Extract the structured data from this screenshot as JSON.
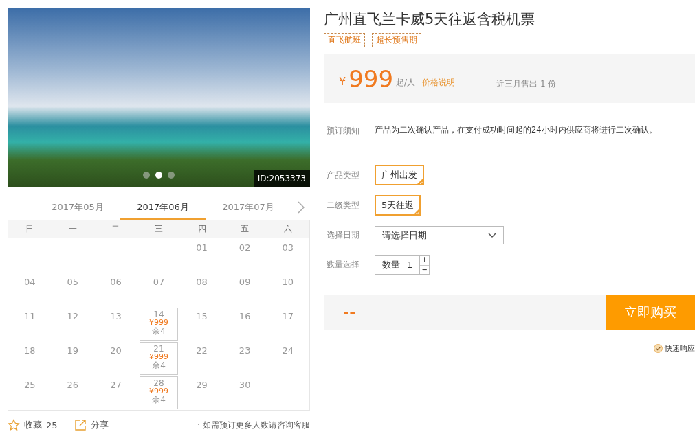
{
  "gallery": {
    "id_label": "ID:2053373",
    "dots": [
      {
        "selected": false
      },
      {
        "selected": true
      },
      {
        "selected": false
      }
    ]
  },
  "calendar": {
    "months": [
      {
        "label": "2017年05月",
        "selected": false
      },
      {
        "label": "2017年06月",
        "selected": true
      },
      {
        "label": "2017年07月",
        "selected": false
      }
    ],
    "weekdays": [
      "日",
      "一",
      "二",
      "三",
      "四",
      "五",
      "六"
    ],
    "weeks": [
      [
        {
          "kind": "blank"
        },
        {
          "kind": "blank"
        },
        {
          "kind": "blank"
        },
        {
          "kind": "blank"
        },
        {
          "kind": "date",
          "day": "01"
        },
        {
          "kind": "date",
          "day": "02"
        },
        {
          "kind": "date",
          "day": "03"
        }
      ],
      [
        {
          "kind": "date",
          "day": "04"
        },
        {
          "kind": "date",
          "day": "05"
        },
        {
          "kind": "date",
          "day": "06"
        },
        {
          "kind": "date",
          "day": "07"
        },
        {
          "kind": "date",
          "day": "08"
        },
        {
          "kind": "date",
          "day": "09"
        },
        {
          "kind": "date",
          "day": "10"
        }
      ],
      [
        {
          "kind": "date",
          "day": "11"
        },
        {
          "kind": "date",
          "day": "12"
        },
        {
          "kind": "date",
          "day": "13"
        },
        {
          "kind": "available",
          "day": "14",
          "price": "¥999",
          "remaining": "余4"
        },
        {
          "kind": "date",
          "day": "15"
        },
        {
          "kind": "date",
          "day": "16"
        },
        {
          "kind": "date",
          "day": "17"
        }
      ],
      [
        {
          "kind": "date",
          "day": "18"
        },
        {
          "kind": "date",
          "day": "19"
        },
        {
          "kind": "date",
          "day": "20"
        },
        {
          "kind": "available",
          "day": "21",
          "price": "¥999",
          "remaining": "余4"
        },
        {
          "kind": "date",
          "day": "22"
        },
        {
          "kind": "date",
          "day": "23"
        },
        {
          "kind": "date",
          "day": "24"
        }
      ],
      [
        {
          "kind": "date",
          "day": "25"
        },
        {
          "kind": "date",
          "day": "26"
        },
        {
          "kind": "date",
          "day": "27"
        },
        {
          "kind": "available",
          "day": "28",
          "price": "¥999",
          "remaining": "余4"
        },
        {
          "kind": "date",
          "day": "29"
        },
        {
          "kind": "date",
          "day": "30"
        },
        {
          "kind": "blank"
        }
      ]
    ]
  },
  "actions": {
    "favorite": "收藏",
    "favorite_count": "25",
    "share": "分享",
    "note": "· 如需预订更多人数请咨询客服"
  },
  "product": {
    "title": "广州直飞兰卡威5天往返含税机票",
    "tags": [
      "直飞航班",
      "超长预售期"
    ],
    "price": {
      "currency": "¥",
      "amount": "999",
      "unit": "起/人",
      "explain_link": "价格说明",
      "sales": "近三月售出 1 份"
    },
    "notice": {
      "label": "预订须知",
      "text": "产品为二次确认产品，在支付成功时间起的24小时内供应商将进行二次确认。"
    },
    "options": [
      {
        "kind": "chips",
        "label": "产品类型",
        "chips": [
          {
            "label": "广州出发",
            "selected": true
          }
        ]
      },
      {
        "kind": "chips",
        "label": "二级类型",
        "chips": [
          {
            "label": "5天往返",
            "selected": true
          }
        ]
      },
      {
        "kind": "select",
        "label": "选择日期",
        "placeholder": "请选择日期"
      },
      {
        "kind": "quantity",
        "label": "数量选择",
        "prefix": "数量",
        "value": "1",
        "plus": "+",
        "minus": "−"
      }
    ],
    "total": "--",
    "buy_button": "立即购买",
    "quick_response": "快速响应"
  }
}
